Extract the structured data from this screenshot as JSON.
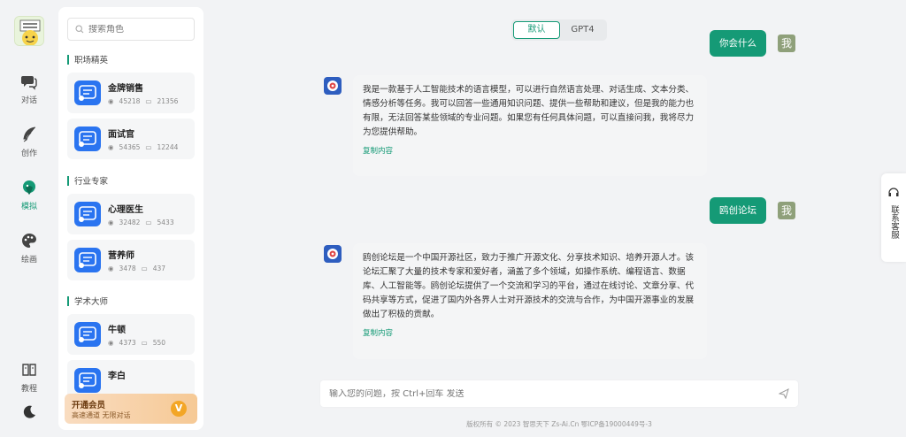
{
  "rail": {
    "items": [
      {
        "label": "对话",
        "icon": "chat-icon"
      },
      {
        "label": "创作",
        "icon": "feather-icon"
      },
      {
        "label": "模拟",
        "icon": "role-icon"
      },
      {
        "label": "绘画",
        "icon": "palette-icon"
      },
      {
        "label": "教程",
        "icon": "book-icon"
      }
    ],
    "active": "模拟",
    "theme_icon": "moon-icon"
  },
  "panel": {
    "search_placeholder": "搜索角色",
    "sections": [
      {
        "title": "职场精英",
        "roles": [
          {
            "name": "金牌销售",
            "views": "45218",
            "chats": "21356"
          },
          {
            "name": "面试官",
            "views": "54365",
            "chats": "12244"
          }
        ]
      },
      {
        "title": "行业专家",
        "roles": [
          {
            "name": "心理医生",
            "views": "32482",
            "chats": "5433"
          },
          {
            "name": "营养师",
            "views": "3478",
            "chats": "437"
          }
        ]
      },
      {
        "title": "学术大师",
        "roles": [
          {
            "name": "牛顿",
            "views": "4373",
            "chats": "550"
          },
          {
            "name": "李白",
            "views": "",
            "chats": ""
          }
        ]
      }
    ],
    "vip": {
      "title": "开通会员",
      "subtitle": "高速通道 无限对话",
      "badge": "V"
    }
  },
  "chat": {
    "tabs": [
      {
        "label": "默认"
      },
      {
        "label": "GPT4"
      }
    ],
    "active_tab": "默认",
    "user_label": "我",
    "messages": [
      {
        "role": "user",
        "text": "你会什么"
      },
      {
        "role": "bot",
        "text": "我是一款基于人工智能技术的语言模型，可以进行自然语言处理、对话生成、文本分类、情感分析等任务。我可以回答一些通用知识问题、提供一些帮助和建议，但是我的能力也有限，无法回答某些领域的专业问题。如果您有任何具体问题，可以直接问我，我将尽力为您提供帮助。",
        "copy": "复制内容"
      },
      {
        "role": "user",
        "text": "鸥创论坛"
      },
      {
        "role": "bot",
        "text": "鸥创论坛是一个中国开源社区，致力于推广开源文化、分享技术知识、培养开源人才。该论坛汇聚了大量的技术专家和爱好者，涵盖了多个领域，如操作系统、编程语言、数据库、人工智能等。鸥创论坛提供了一个交流和学习的平台，通过在线讨论、文章分享、代码共享等方式，促进了国内外各界人士对开源技术的交流与合作，为中国开源事业的发展做出了积极的贡献。",
        "copy": "复制内容"
      }
    ],
    "input_placeholder": "输入您的问题，按 Ctrl+回车 发送",
    "footer": "版权所有 © 2023 智思天下 Zs-Ai.Cn    鄂ICP备19000449号-3"
  },
  "service": {
    "label": "联系客服"
  },
  "colors": {
    "accent": "#159a76",
    "role_icon": "#2a74f0"
  }
}
